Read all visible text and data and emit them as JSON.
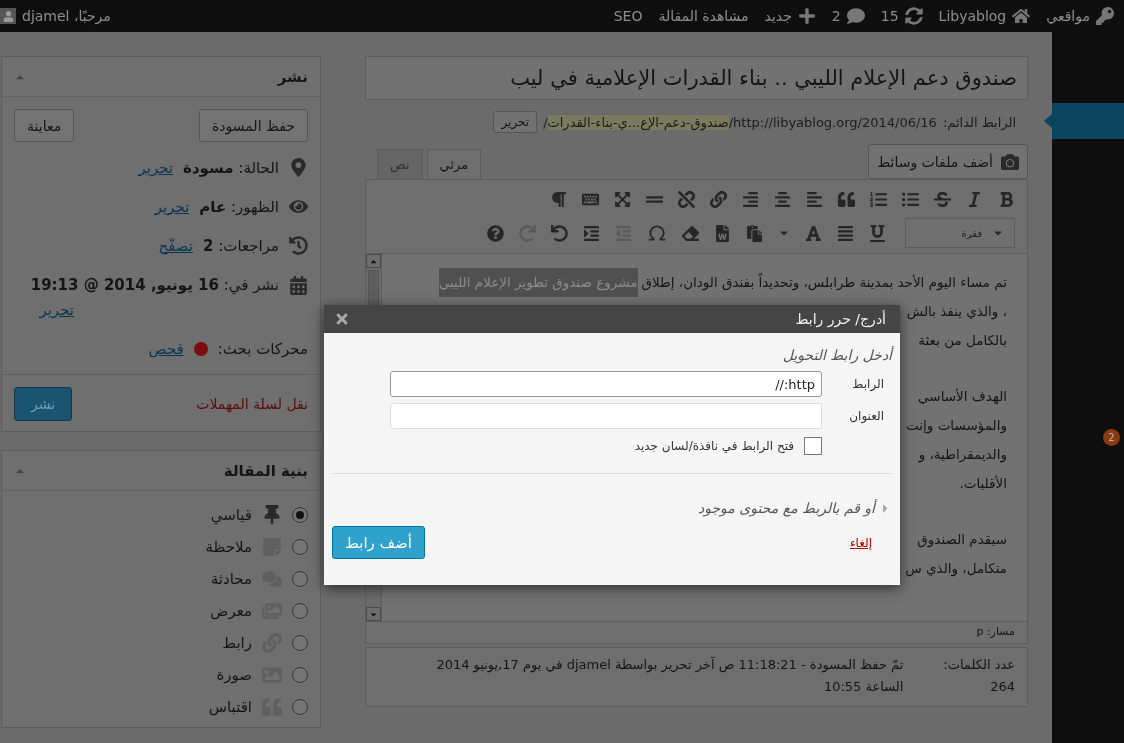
{
  "admin_bar": {
    "items": [
      {
        "kind": "sites",
        "label": "مواقعي"
      },
      {
        "kind": "home",
        "label": "Libyablog"
      },
      {
        "kind": "updates",
        "label": "15"
      },
      {
        "kind": "comments",
        "label": "2"
      },
      {
        "kind": "new",
        "label": "جديد"
      },
      {
        "kind": "text",
        "label": "مشاهدة المقالة"
      },
      {
        "kind": "text",
        "label": "SEO"
      }
    ],
    "account": "مرحبًا، djamel"
  },
  "admin_menu": {
    "badge": "2"
  },
  "post": {
    "title": "صندوق دعم الإعلام الليبي .. بناء القدرات الإعلامية في ليب",
    "permalink": {
      "label": "الرابط الدائم:",
      "url": "http://libyablog.org/2014/06/16/",
      "slug": "صندوق-دعم-الإع...ي-بناء-القدرات",
      "suffix": "/",
      "edit_button": "تحرير"
    },
    "media_button": "أضف ملفات وسائط"
  },
  "editor_tabs": [
    {
      "label": "مرئي",
      "selected": true
    },
    {
      "label": "نص",
      "selected": false
    }
  ],
  "toolbar": {
    "row_1": [
      {
        "kind": "bold",
        "disabled": false
      },
      {
        "kind": "italic",
        "disabled": false
      },
      {
        "kind": "strikethrough",
        "disabled": false
      },
      {
        "kind": "bullet_list",
        "disabled": false
      },
      {
        "kind": "numbered_list",
        "disabled": false
      },
      {
        "kind": "blockquote",
        "disabled": false
      },
      {
        "kind": "align_left",
        "disabled": false
      },
      {
        "kind": "align_center",
        "disabled": false
      },
      {
        "kind": "align_right",
        "disabled": false
      },
      {
        "kind": "link",
        "disabled": false
      },
      {
        "kind": "unlink",
        "disabled": false
      },
      {
        "kind": "read_more",
        "disabled": false
      },
      {
        "kind": "fullscreen",
        "disabled": false
      },
      {
        "kind": "toolbar_toggle",
        "disabled": false
      },
      {
        "kind": "text_direction",
        "disabled": false
      }
    ],
    "format_select": "فقرة",
    "row_2": [
      {
        "kind": "underline",
        "disabled": false
      },
      {
        "kind": "justify",
        "disabled": false
      },
      {
        "kind": "text_color",
        "disabled": false
      },
      {
        "kind": "paste_text",
        "disabled": false
      },
      {
        "kind": "paste_word",
        "disabled": false
      },
      {
        "kind": "clear_formatting",
        "disabled": false
      },
      {
        "kind": "special_character",
        "disabled": false
      },
      {
        "kind": "outdent",
        "disabled": true
      },
      {
        "kind": "indent",
        "disabled": false
      },
      {
        "kind": "undo",
        "disabled": false
      },
      {
        "kind": "redo",
        "disabled": true
      },
      {
        "kind": "help",
        "disabled": false
      }
    ]
  },
  "content": [
    {
      "lines": [
        {
          "text": "تم مساء اليوم الأحد بمدينة طرابلس، وتحديداً بفندق الودان، إطلاق",
          "highlight": "مشروع صندوق تطوير الإعلام الليبي"
        },
        {
          "text": "، والذي ينفذ بالش"
        },
        {
          "text": "بالكامل من بعثة"
        }
      ]
    },
    {
      "lines": [
        {
          "text": "الهدف الأساسي"
        },
        {
          "text": "والمؤسسات وإنت"
        },
        {
          "text": "والديمقراطية، و"
        },
        {
          "text": "الأقليات."
        }
      ]
    },
    {
      "lines": [
        {
          "text": "سيقدم الصندوق"
        },
        {
          "text": "متكامل، والذي س"
        }
      ]
    }
  ],
  "path": "مسار: p",
  "footer": {
    "word_count_label": "عدد الكلمات:",
    "word_count": "264",
    "saved": "تمّ حفظ المسودة - 11:18:21 ص آخر تحرير بواسطة djamel في يوم 17,يونيو 2014 الساعة 10:55"
  },
  "publish": {
    "title": "نشر",
    "save_draft": "حفظ المسودة",
    "preview": "معاينة",
    "rows": [
      {
        "kind": "status",
        "text": "الحالة: **مسودة**",
        "link": "تحرير"
      },
      {
        "kind": "visibility",
        "text": "الظهور: **عام**",
        "link": "تحرير"
      },
      {
        "kind": "revisions",
        "text": "مراجعات: **2**",
        "link": "تصفّح"
      },
      {
        "kind": "schedule",
        "text": "نشر في: **16 يونيو, 2014 @ 19:13**",
        "link": "تحرير"
      },
      {
        "kind": "seo",
        "text": "محركات بحث:",
        "color": "#7a0f0f",
        "link": "فحص"
      }
    ],
    "trash": "نقل لسلة المهملات",
    "publish_button": "نشر"
  },
  "post_format": {
    "title": "بنية المقالة",
    "items": [
      {
        "kind": "standard",
        "label": "قياسي",
        "selected": true
      },
      {
        "kind": "aside",
        "label": "ملاحظة",
        "selected": false
      },
      {
        "kind": "chat",
        "label": "محادثة",
        "selected": false
      },
      {
        "kind": "gallery",
        "label": "معرض",
        "selected": false
      },
      {
        "kind": "link",
        "label": "رابط",
        "selected": false
      },
      {
        "kind": "image",
        "label": "صورة",
        "selected": false
      },
      {
        "kind": "quote",
        "label": "اقتباس",
        "selected": false
      }
    ]
  },
  "modal": {
    "title": "أدرج/ حرر رابط",
    "intro": "أدخل رابط التحويل",
    "fields": [
      {
        "label": "الرابط",
        "value": "http://"
      },
      {
        "label": "العنوان"
      }
    ],
    "new_tab": {
      "label": "فتح الرابط في نافذة/لسان جديد",
      "checked": false
    },
    "existing": {
      "label": "أو قم بالربط مع محتوى موجود",
      "expanded": false
    },
    "cancel": "إلغاء",
    "submit": "أضف رابط"
  }
}
